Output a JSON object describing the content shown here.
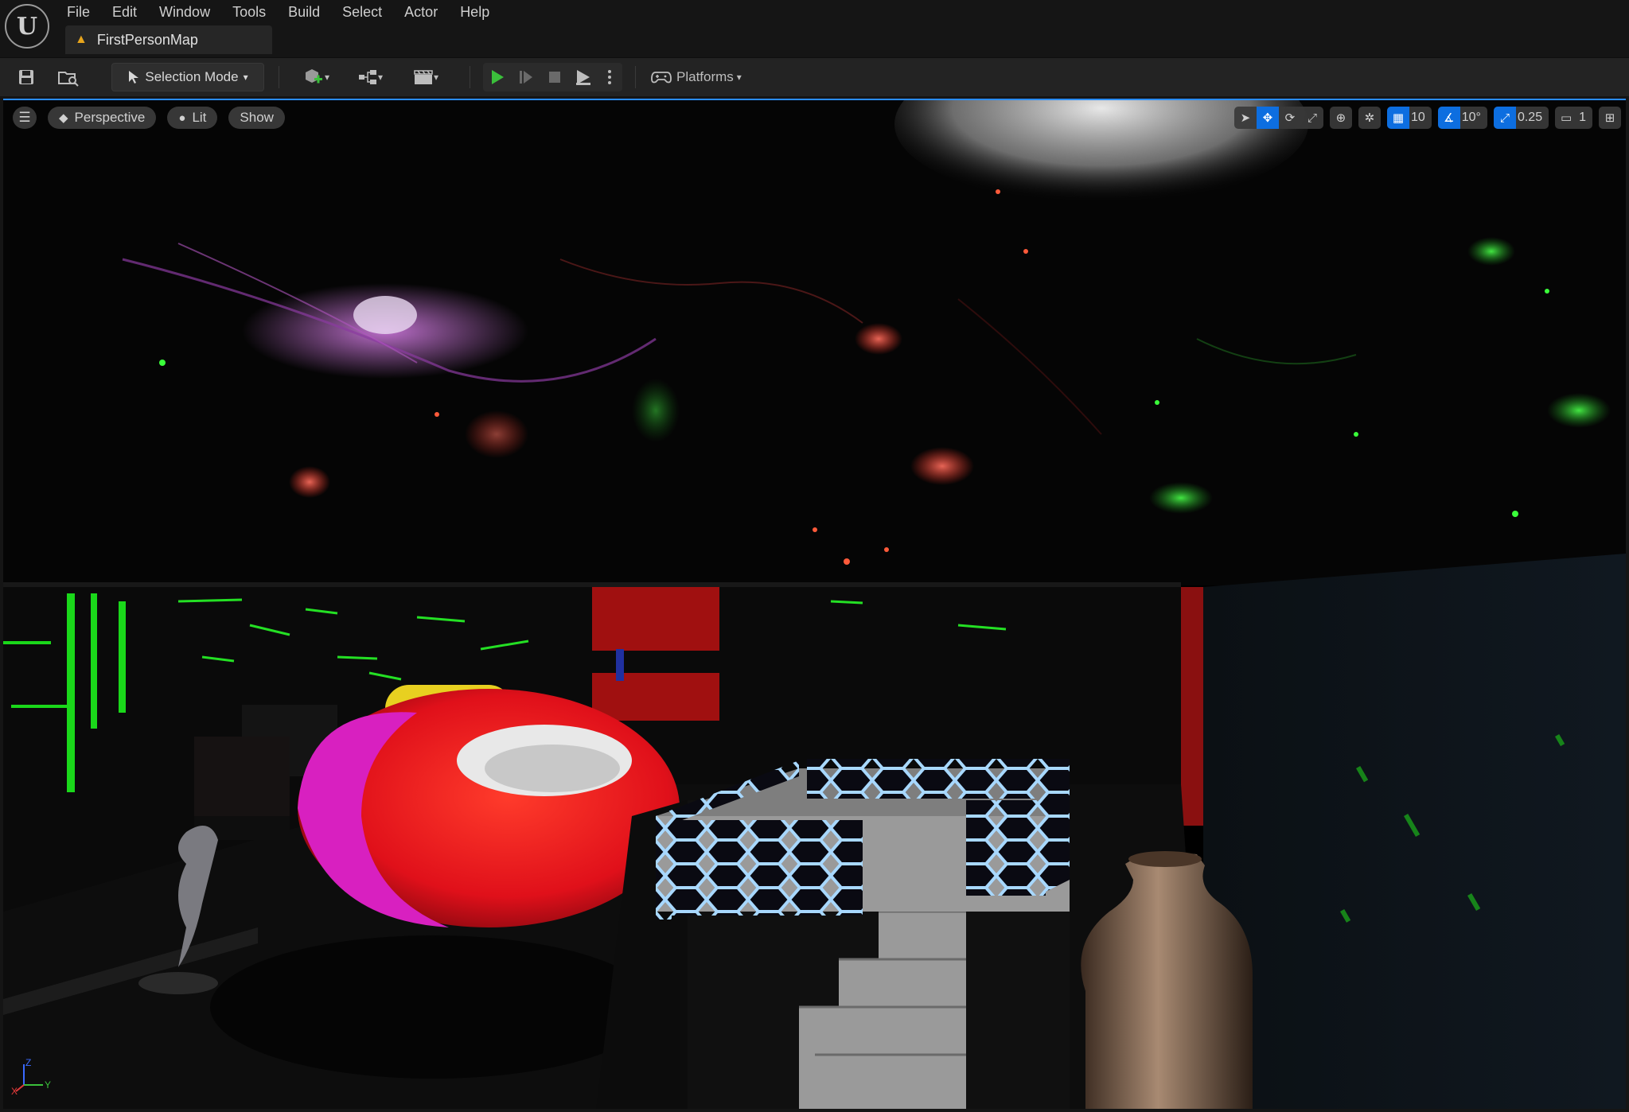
{
  "app": {
    "logo_glyph": "U"
  },
  "menu": {
    "items": [
      "File",
      "Edit",
      "Window",
      "Tools",
      "Build",
      "Select",
      "Actor",
      "Help"
    ]
  },
  "document_tab": {
    "title": "FirstPersonMap",
    "icon": "warning-triangle-icon"
  },
  "toolbar": {
    "selection_mode_label": "Selection Mode",
    "platforms_label": "Platforms"
  },
  "viewport": {
    "view_mode": "Perspective",
    "lighting": "Lit",
    "show_label": "Show",
    "grid_snap": "10",
    "rotation_snap": "10°",
    "scale_snap": "0.25",
    "camera_speed": "1",
    "axis_labels": {
      "x": "X",
      "y": "Y",
      "z": "Z"
    }
  },
  "colors": {
    "accent": "#0d6ee0",
    "play_green": "#3bbf3b",
    "warning": "#e8a51c"
  }
}
